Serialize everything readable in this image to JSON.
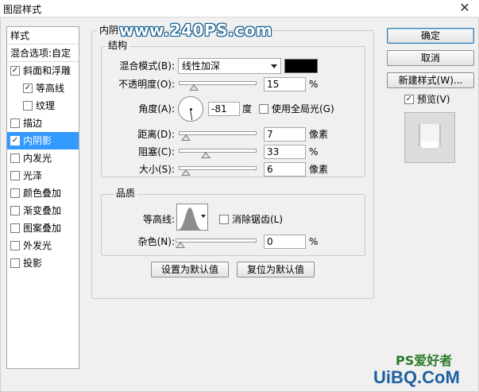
{
  "window": {
    "title": "图层样式",
    "close_glyph": "✕"
  },
  "watermark_top": "www.240PS.com",
  "styles": {
    "header": "样式",
    "blend_options": "混合选项:自定",
    "items": [
      {
        "label": "斜面和浮雕",
        "checked": true
      },
      {
        "label": "等高线",
        "checked": true
      },
      {
        "label": "纹理",
        "checked": false
      },
      {
        "label": "描边",
        "checked": false
      },
      {
        "label": "内阴影",
        "checked": true,
        "selected": true
      },
      {
        "label": "内发光",
        "checked": false
      },
      {
        "label": "光泽",
        "checked": false
      },
      {
        "label": "颜色叠加",
        "checked": false
      },
      {
        "label": "渐变叠加",
        "checked": false
      },
      {
        "label": "图案叠加",
        "checked": false
      },
      {
        "label": "外发光",
        "checked": false
      },
      {
        "label": "投影",
        "checked": false
      }
    ]
  },
  "inner_shadow": {
    "group_title": "内阴",
    "structure": {
      "title": "结构",
      "blend_mode_label": "混合模式(B):",
      "blend_mode_value": "线性加深",
      "shadow_color": "#000000",
      "opacity_label": "不透明度(O):",
      "opacity_value": "15",
      "opacity_unit": "%",
      "opacity_fraction": 0.15,
      "angle_label": "角度(A):",
      "angle_value": "-81",
      "angle_degrees": -81,
      "angle_unit": "度",
      "global_light_label": "使用全局光(G)",
      "global_light_checked": false,
      "distance_label": "距离(D):",
      "distance_value": "7",
      "distance_unit": "像素",
      "distance_fraction": 0.03,
      "choke_label": "阻塞(C):",
      "choke_value": "33",
      "choke_unit": "%",
      "choke_fraction": 0.33,
      "size_label": "大小(S):",
      "size_value": "6",
      "size_unit": "像素",
      "size_fraction": 0.04
    },
    "quality": {
      "title": "品质",
      "contour_label": "等高线:",
      "antialias_label": "消除锯齿(L)",
      "antialias_checked": false,
      "noise_label": "杂色(N):",
      "noise_value": "0",
      "noise_unit": "%",
      "noise_fraction": 0.0
    },
    "make_default": "设置为默认值",
    "reset_default": "复位为默认值"
  },
  "buttons": {
    "ok": "确定",
    "cancel": "取消",
    "new_style": "新建样式(W)...",
    "preview_label": "预览(V)",
    "preview_checked": true
  },
  "watermark_bottom": {
    "brand": "PS爱好者",
    "site": "UiBQ.CoM"
  },
  "colors": {
    "selected": "#3399ff",
    "accent_border": "#3c7fb1"
  }
}
